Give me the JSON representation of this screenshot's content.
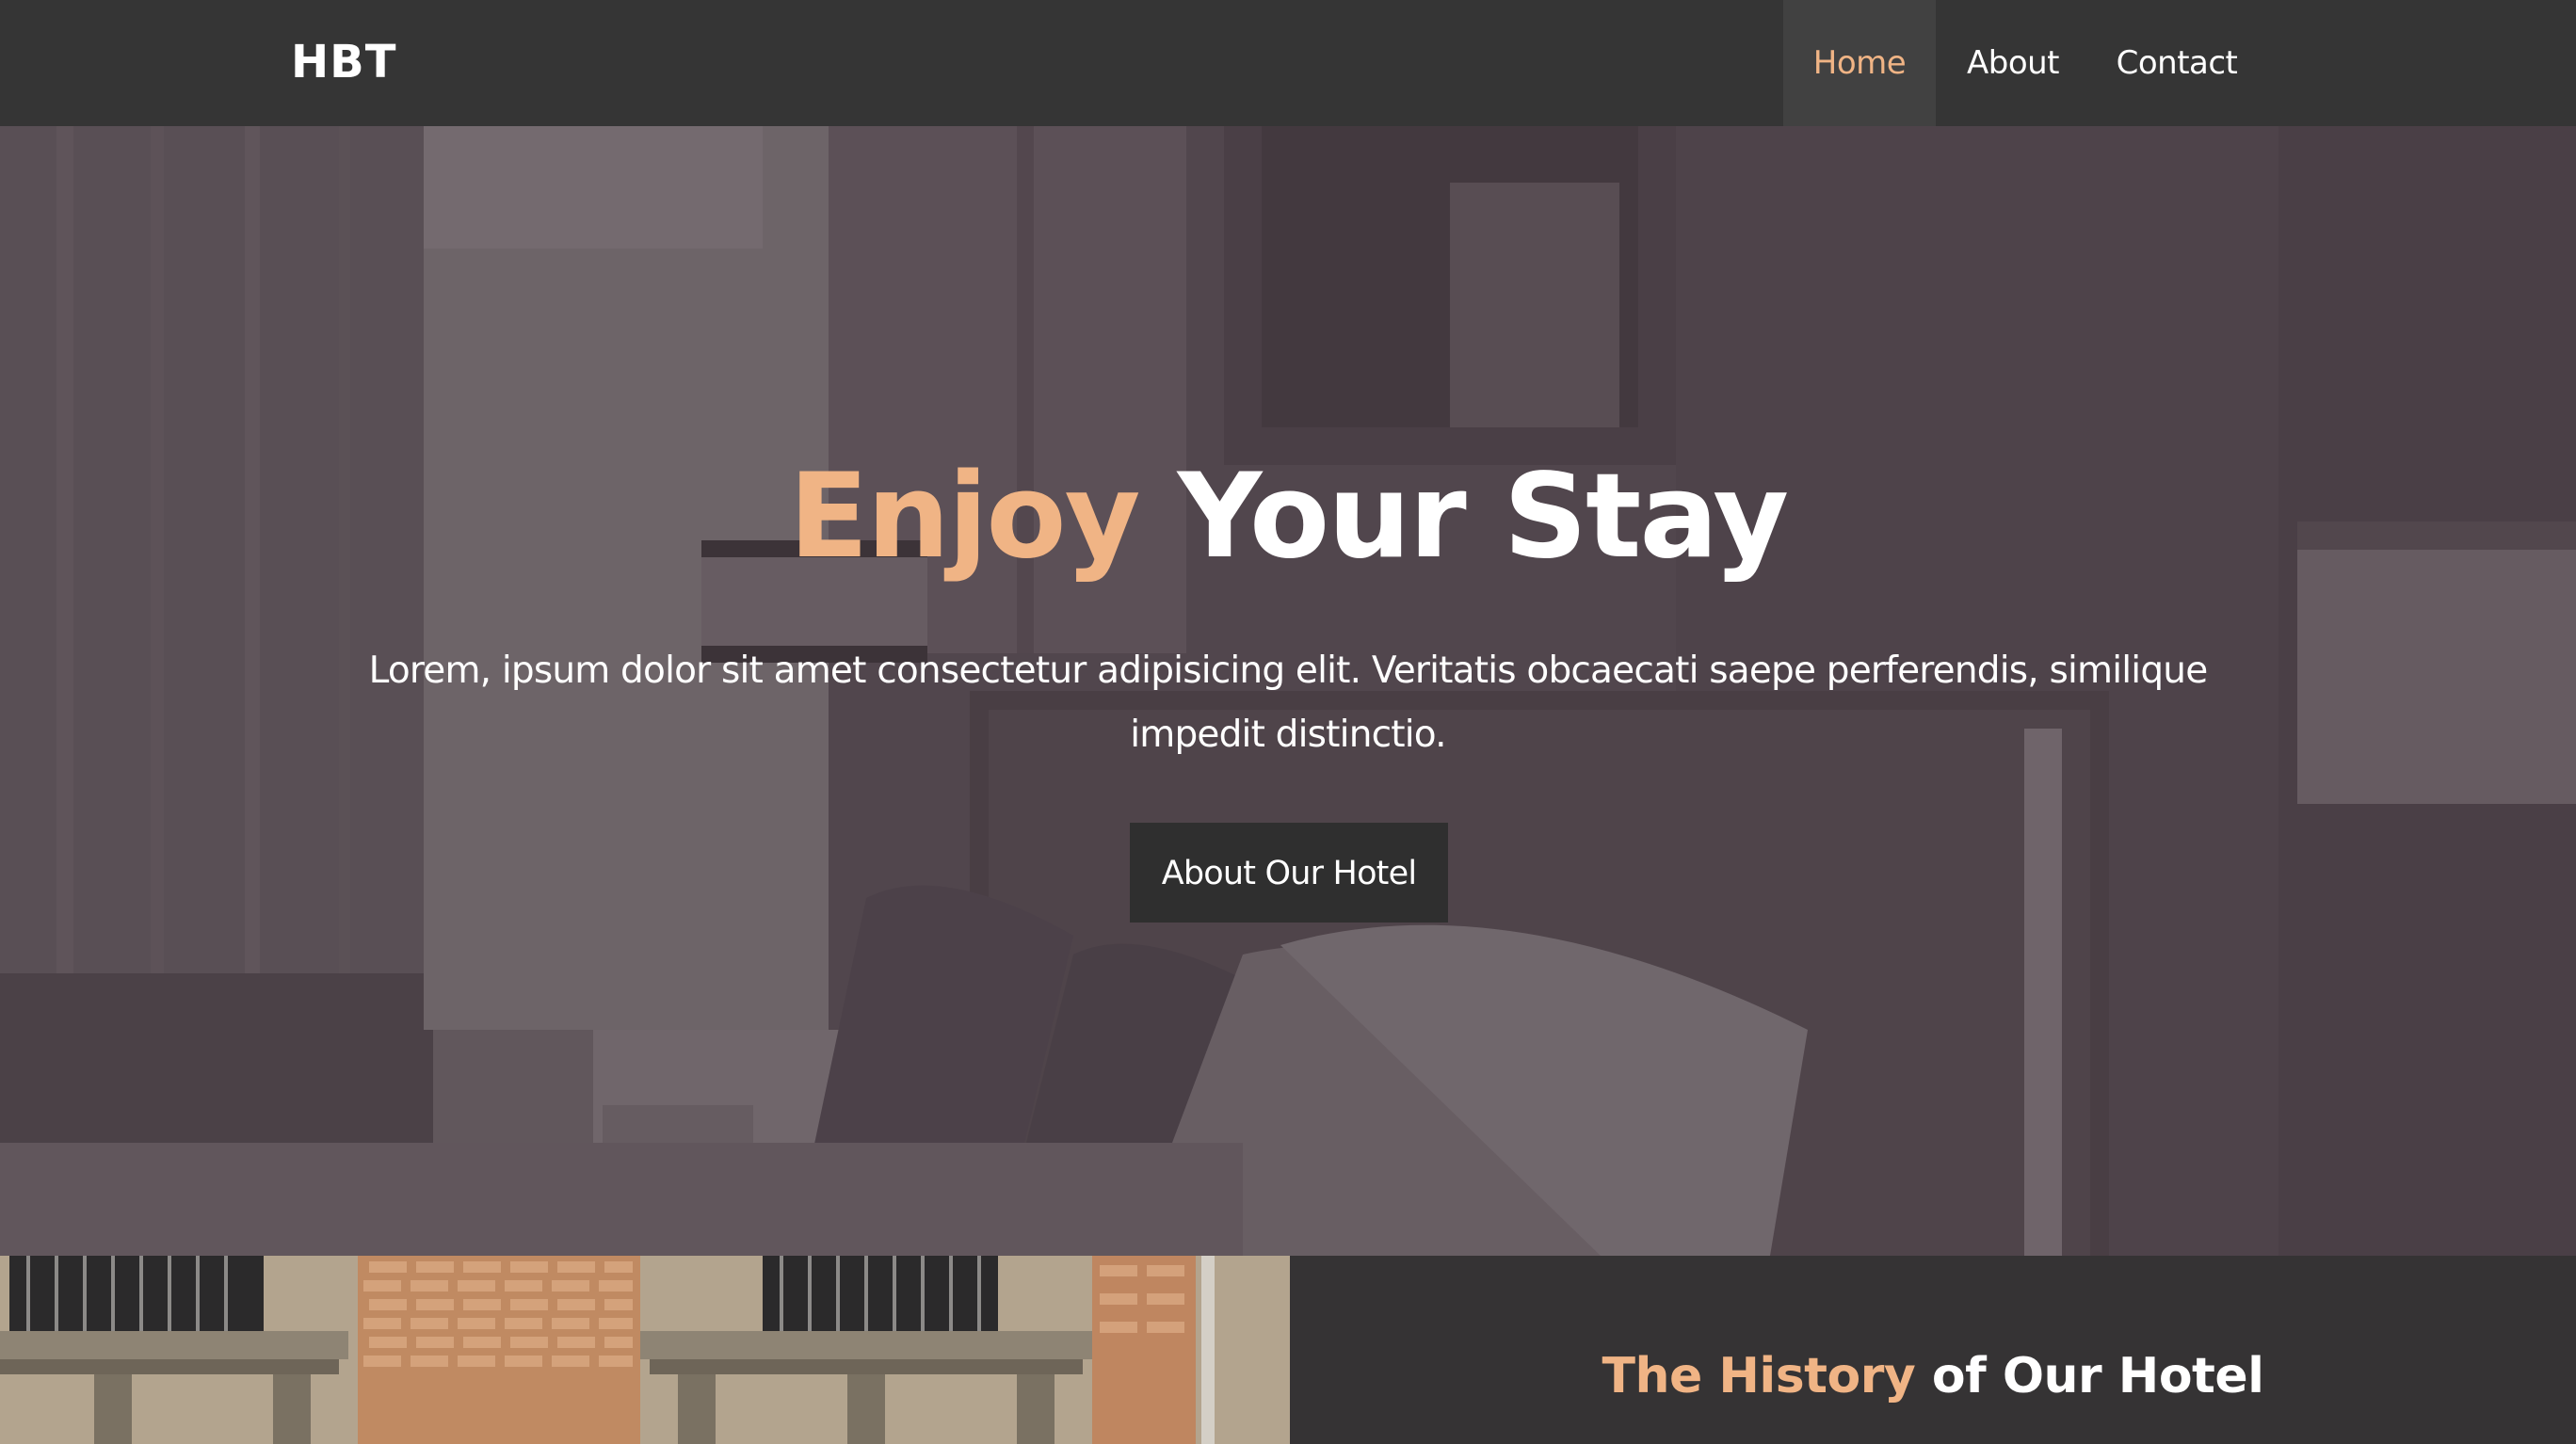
{
  "navbar": {
    "brand": "HBT",
    "links": [
      {
        "label": "Home",
        "active": true
      },
      {
        "label": "About",
        "active": false
      },
      {
        "label": "Contact",
        "active": false
      }
    ]
  },
  "hero": {
    "title_accent": "Enjoy",
    "title_rest": " Your Stay",
    "text": "Lorem, ipsum dolor sit amet consectetur adipisicing elit. Veritatis obcaecati saepe perferendis, similique impedit distinctio.",
    "button_label": "About Our Hotel"
  },
  "history": {
    "title_accent": "The History",
    "title_rest": " of Our Hotel"
  },
  "colors": {
    "accent": "#f0b485",
    "navbar_bg": "#353535",
    "active_link_bg": "#414141",
    "button_bg": "#2f2f2f",
    "panel_bg": "#353334"
  }
}
